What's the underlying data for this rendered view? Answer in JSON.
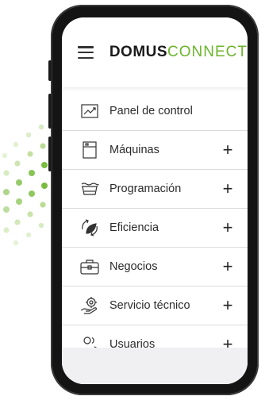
{
  "colors": {
    "brand_green": "#6bb52a",
    "text_dark": "#2b2b2b",
    "phone_frame": "#141414"
  },
  "header": {
    "menu_icon": "hamburger-icon",
    "logo_bold": "DOMUS",
    "logo_light": "CONNECT"
  },
  "menu": {
    "items": [
      {
        "label": "Panel de control",
        "icon": "trend-chart-icon",
        "expandable": false
      },
      {
        "label": "Máquinas",
        "icon": "appliance-icon",
        "expandable": true
      },
      {
        "label": "Programación",
        "icon": "wash-tub-icon",
        "expandable": true
      },
      {
        "label": "Eficiencia",
        "icon": "recycle-leaf-icon",
        "expandable": true
      },
      {
        "label": "Negocios",
        "icon": "briefcase-icon",
        "expandable": true
      },
      {
        "label": "Servicio técnico",
        "icon": "gear-hand-icon",
        "expandable": true
      },
      {
        "label": "Usuarios",
        "icon": "users-icon",
        "expandable": true
      }
    ],
    "expand_symbol": "+"
  }
}
